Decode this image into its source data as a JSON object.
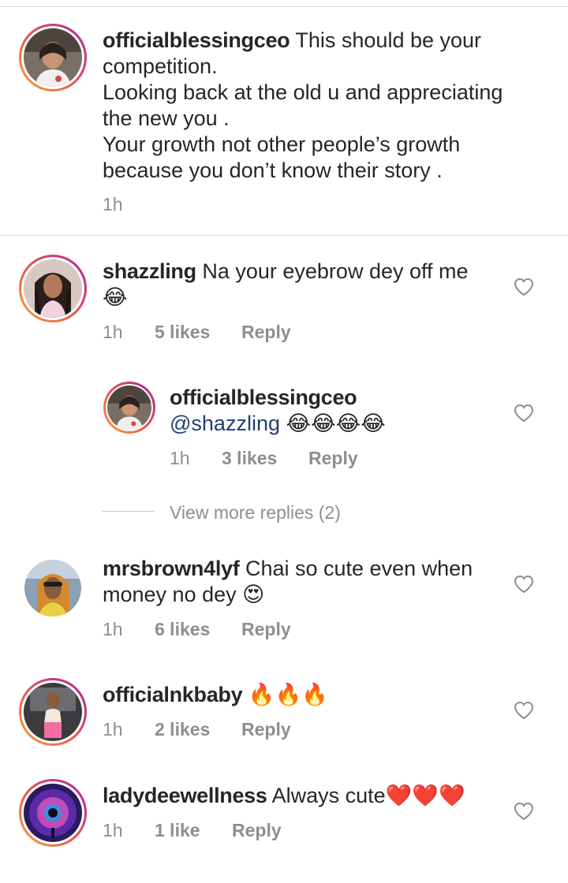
{
  "comments": [
    {
      "username": "officialblessingceo",
      "text_line1": "This should be your",
      "text_rest": [
        "competition.",
        "Looking back at the old u and appreciating",
        "the new you .",
        "Your growth not other people’s growth",
        "because you don’t know their story ."
      ],
      "time": "1h"
    },
    {
      "username": "shazzling",
      "text": "Na your eyebrow dey off me",
      "emoji": "😂",
      "time": "1h",
      "likes": "5 likes",
      "reply": "Reply"
    },
    {
      "username": "officialblessingceo",
      "mention": "@shazzling",
      "emoji": "😂😂😂😂",
      "time": "1h",
      "likes": "3 likes",
      "reply": "Reply"
    },
    {
      "username": "mrsbrown4lyf",
      "text_line1": "Chai so cute even when",
      "text_line2": "money no dey",
      "emoji": "😍",
      "time": "1h",
      "likes": "6 likes",
      "reply": "Reply"
    },
    {
      "username": "officialnkbaby",
      "emoji": "🔥🔥🔥",
      "time": "1h",
      "likes": "2 likes",
      "reply": "Reply"
    },
    {
      "username": "ladydeewellness",
      "text": "Always cute",
      "emoji": "❤️❤️❤️",
      "time": "1h",
      "likes": "1 like",
      "reply": "Reply"
    }
  ],
  "view_more": "View more replies (2)",
  "icons": {
    "like": "heart-outline-icon"
  },
  "colors": {
    "text": "#262626",
    "meta": "#8e8e8e",
    "mention": "#1f3f73",
    "ring": "#e95950"
  }
}
